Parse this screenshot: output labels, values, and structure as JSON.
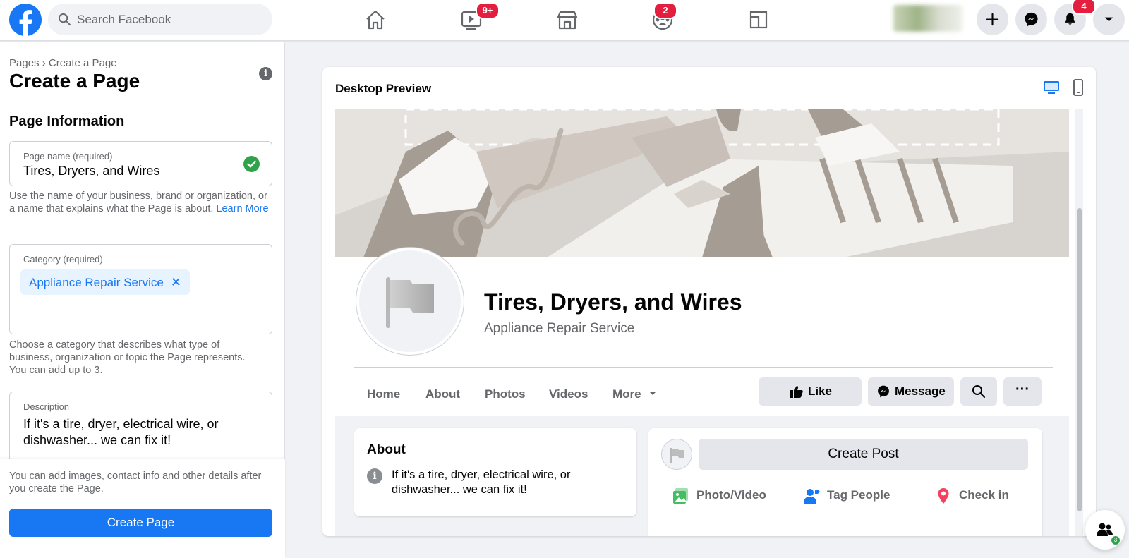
{
  "topbar": {
    "search_placeholder": "Search Facebook",
    "watch_badge": "9+",
    "groups_badge": "2",
    "notifications_badge": "4"
  },
  "sidebar": {
    "breadcrumb": "Pages › Create a Page",
    "title": "Create a Page",
    "section_title": "Page Information",
    "page_name": {
      "label": "Page name (required)",
      "value": "Tires, Dryers, and Wires",
      "help": "Use the name of your business, brand or organization, or a name that explains what the Page is about.",
      "help_link": "Learn More"
    },
    "category": {
      "label": "Category (required)",
      "chip": "Appliance Repair Service",
      "remove": "✕",
      "help": "Choose a category that describes what type of business, organization or topic the Page represents. You can add up to 3."
    },
    "description": {
      "label": "Description",
      "value": "If it's a tire, dryer, electrical wire, or dishwasher... we can fix it!"
    },
    "bottom_note": "You can add images, contact info and other details after you create the Page.",
    "create_button": "Create Page"
  },
  "preview": {
    "title": "Desktop Preview",
    "page_name": "Tires, Dryers, and Wires",
    "category": "Appliance Repair Service",
    "tabs": [
      "Home",
      "About",
      "Photos",
      "Videos",
      "More"
    ],
    "buttons": {
      "like": "Like",
      "message": "Message",
      "more": "···"
    },
    "about": {
      "title": "About",
      "text": "If it's a tire, dryer, electrical wire, or dishwasher... we can fix it!"
    },
    "create_post": "Create Post",
    "post_actions": [
      "Photo/Video",
      "Tag People",
      "Check in"
    ]
  },
  "contacts_badge": "3",
  "colors": {
    "brand": "#1877f2",
    "badge": "#e41e3f",
    "success": "#31a24c",
    "background": "#f0f2f5"
  }
}
